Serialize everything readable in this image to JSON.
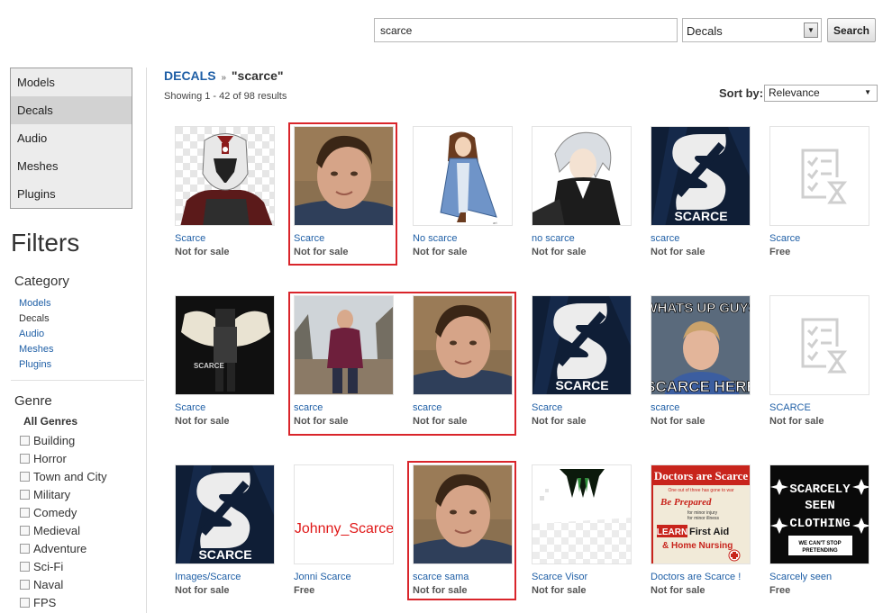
{
  "search": {
    "value": "scarce",
    "type_selected": "Decals",
    "button_label": "Search"
  },
  "menu": [
    {
      "label": "Models",
      "active": false
    },
    {
      "label": "Decals",
      "active": true
    },
    {
      "label": "Audio",
      "active": false
    },
    {
      "label": "Meshes",
      "active": false
    },
    {
      "label": "Plugins",
      "active": false
    }
  ],
  "filters": {
    "title": "Filters",
    "category_title": "Category",
    "categories": [
      "Models",
      "Decals",
      "Audio",
      "Meshes",
      "Plugins"
    ],
    "genre_title": "Genre",
    "all_genres": "All Genres",
    "genres": [
      "Building",
      "Horror",
      "Town and City",
      "Military",
      "Comedy",
      "Medieval",
      "Adventure",
      "Sci-Fi",
      "Naval",
      "FPS"
    ]
  },
  "main": {
    "breadcrumb_link": "DECALS",
    "breadcrumb_sep": "»",
    "breadcrumb_query": "\"scarce\"",
    "result_count": "Showing 1 - 42 of 98 results",
    "sort_label": "Sort by:",
    "sort_value": "Relevance"
  },
  "items": [
    {
      "name": "Scarce",
      "price": "Not for sale",
      "icon": "clone-trooper-image"
    },
    {
      "name": "Scarce",
      "price": "Not for sale",
      "icon": "face-photo-image"
    },
    {
      "name": "No scarce",
      "price": "Not for sale",
      "icon": "anime-girl-image"
    },
    {
      "name": "no scarce",
      "price": "Not for sale",
      "icon": "anime-boy-image"
    },
    {
      "name": "scarce",
      "price": "Not for sale",
      "icon": "scarce-logo-image",
      "logo_text": "SCARCE"
    },
    {
      "name": "Scarce",
      "price": "Free",
      "icon": "pending-image-placeholder"
    },
    {
      "name": "Scarce",
      "price": "Not for sale",
      "icon": "winged-figure-image",
      "logo_text": "SCARCE"
    },
    {
      "name": "scarce",
      "price": "Not for sale",
      "icon": "full-body-photo-image"
    },
    {
      "name": "scarce",
      "price": "Not for sale",
      "icon": "face-photo-image"
    },
    {
      "name": "Scarce",
      "price": "Not for sale",
      "icon": "scarce-logo-image",
      "logo_text": "SCARCE"
    },
    {
      "name": "scarce",
      "price": "Not for sale",
      "icon": "meme-photo-image",
      "meme_top": "WHATS UP GUYS",
      "meme_bottom": "SCARCE HERE"
    },
    {
      "name": "SCARCE",
      "price": "Not for sale",
      "icon": "pending-image-placeholder"
    },
    {
      "name": "Images/Scarce",
      "price": "Not for sale",
      "icon": "scarce-logo-image",
      "logo_text": "SCARCE"
    },
    {
      "name": "Jonni Scarce",
      "price": "Free",
      "icon": "johnny-scarce-text-image",
      "text": "Johnny_Scarce"
    },
    {
      "name": "scarce sama",
      "price": "Not for sale",
      "icon": "face-photo-image"
    },
    {
      "name": "Scarce Visor",
      "price": "Not for sale",
      "icon": "visor-image"
    },
    {
      "name": "Doctors are Scarce !",
      "price": "Not for sale",
      "icon": "doctors-poster-image",
      "poster_title": "Doctors are Scarce",
      "poster_sub1": "One out of three has gone to war",
      "poster_prep": "Be Prepared",
      "poster_minor": "for minor injury",
      "poster_minor2": "for minor illness",
      "poster_learn": "LEARN",
      "poster_first": "First Aid",
      "poster_home": "& Home Nursing"
    },
    {
      "name": "Scarcely seen",
      "price": "Free",
      "icon": "scarcely-seen-clothing-image",
      "line1": "SCARCELY",
      "line2": "SEEN",
      "line3": "CLOTHING",
      "line4": "WE CAN'T STOP",
      "line5": "PRETENDING"
    }
  ],
  "colors": {
    "link": "#1f5fa6",
    "highlight": "#d9252b",
    "menu_bg": "#ececec",
    "menu_active": "#d2d2d2"
  }
}
